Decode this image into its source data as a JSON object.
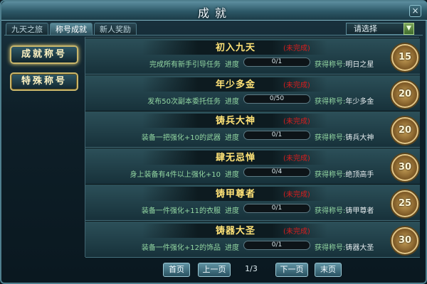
{
  "window": {
    "title": "成就",
    "close_label": "×"
  },
  "tabs": [
    {
      "label": "九天之旅",
      "active": false
    },
    {
      "label": "称号成就",
      "active": true
    },
    {
      "label": "新人奖励",
      "active": false
    }
  ],
  "filter": {
    "selected": "请选择",
    "arrow_icon": "triangle-down-icon"
  },
  "categories": [
    {
      "label": "成就称号",
      "selected": true
    },
    {
      "label": "特殊称号",
      "selected": false
    }
  ],
  "labels": {
    "progress": "进度",
    "reward_prefix": "获得称号:"
  },
  "achievements": [
    {
      "name": "初入九天",
      "status": "(未完成)",
      "desc": "完成所有新手引导任务",
      "progress_text": "0/1",
      "progress_fraction": 0,
      "reward": "明日之星",
      "points": "15"
    },
    {
      "name": "年少多金",
      "status": "(未完成)",
      "desc": "发布50次副本委托任务",
      "progress_text": "0/50",
      "progress_fraction": 0,
      "reward": "年少多金",
      "points": "20"
    },
    {
      "name": "铸兵大神",
      "status": "(未完成)",
      "desc": "装备一把强化+10的武器",
      "progress_text": "0/1",
      "progress_fraction": 0,
      "reward": "铸兵大神",
      "points": "20"
    },
    {
      "name": "肆无忌惮",
      "status": "(未完成)",
      "desc": "身上装备有4件以上强化+10",
      "progress_text": "0/4",
      "progress_fraction": 0,
      "reward": "绝顶高手",
      "points": "30"
    },
    {
      "name": "铸甲尊者",
      "status": "(未完成)",
      "desc": "装备一件强化+11的衣服",
      "progress_text": "0/1",
      "progress_fraction": 0,
      "reward": "铸甲尊者",
      "points": "25"
    },
    {
      "name": "铸器大圣",
      "status": "(未完成)",
      "desc": "装备一件强化+12的饰品",
      "progress_text": "0/1",
      "progress_fraction": 0,
      "reward": "铸器大圣",
      "points": "30"
    }
  ],
  "pager": {
    "first": "首页",
    "prev": "上一页",
    "page": "1/3",
    "next": "下一页",
    "last": "末页"
  }
}
